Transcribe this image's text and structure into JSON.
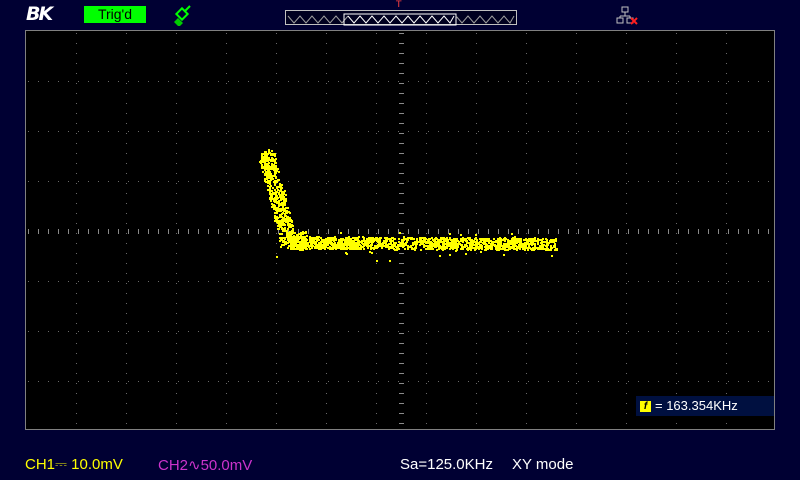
{
  "header": {
    "brand": "BK",
    "trigger_status": "Trig'd",
    "trigger_marker": "T",
    "icons": [
      "probe-icon",
      "network-disconnected-icon"
    ]
  },
  "screen": {
    "mode": "XY",
    "trace_color": "#ffff00",
    "frequency_value": "= 163.354KHz",
    "frequency_icon_label": "f"
  },
  "footer": {
    "ch1": "CH1⎓ 10.0mV",
    "ch2": "CH2∿50.0mV",
    "sample_rate": "Sa=125.0KHz",
    "mode_label": "XY mode"
  },
  "colors": {
    "background": "#000033",
    "ch1": "#ffff00",
    "ch2": "#cc33cc",
    "trig_badge": "#00ff00"
  }
}
